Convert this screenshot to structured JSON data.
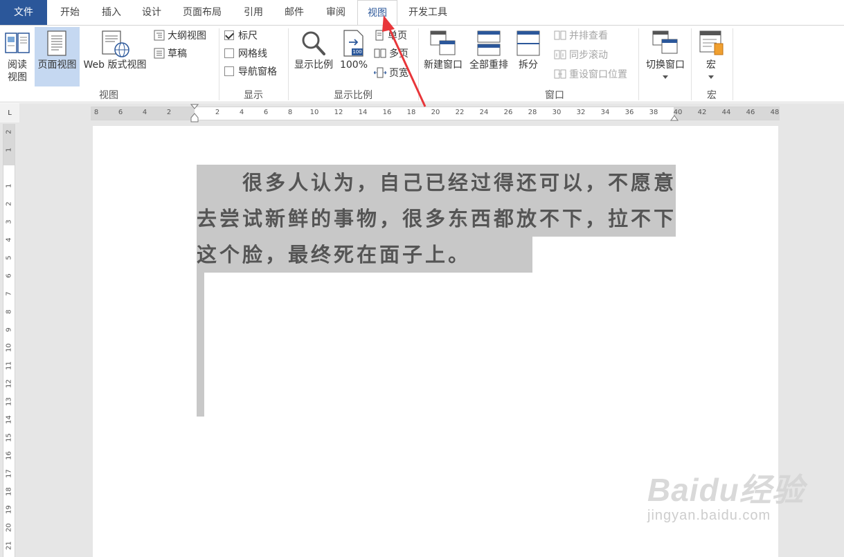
{
  "tabs": [
    {
      "label": "文件"
    },
    {
      "label": "开始"
    },
    {
      "label": "插入"
    },
    {
      "label": "设计"
    },
    {
      "label": "页面布局"
    },
    {
      "label": "引用"
    },
    {
      "label": "邮件"
    },
    {
      "label": "审阅"
    },
    {
      "label": "视图"
    },
    {
      "label": "开发工具"
    }
  ],
  "active_tab": "视图",
  "groups": {
    "views": {
      "label": "视图",
      "read_mode_line1": "阅读",
      "read_mode_line2": "视图",
      "print_layout": "页面视图",
      "web_layout": "Web 版式视图",
      "outline": "大纲视图",
      "draft": "草稿"
    },
    "show": {
      "label": "显示",
      "ruler": "标尺",
      "ruler_checked": true,
      "gridlines": "网格线",
      "gridlines_checked": false,
      "nav_pane": "导航窗格",
      "nav_pane_checked": false
    },
    "zoom": {
      "label": "显示比例",
      "zoom": "显示比例",
      "hundred": "100%",
      "one_page": "单页",
      "multi_page": "多页",
      "page_width": "页宽",
      "icon_badge": "100"
    },
    "window": {
      "label": "窗口",
      "new_window": "新建窗口",
      "arrange_all": "全部重排",
      "split": "拆分",
      "side_by_side": "并排查看",
      "sync_scroll": "同步滚动",
      "reset_position": "重设窗口位置",
      "switch_windows": "切换窗口"
    },
    "macros": {
      "label": "宏",
      "macros": "宏"
    }
  },
  "ruler": {
    "corner": "L",
    "h_labels": [
      "8",
      "6",
      "4",
      "2",
      "",
      "2",
      "4",
      "6",
      "8",
      "10",
      "12",
      "14",
      "16",
      "18",
      "20",
      "22",
      "24",
      "26",
      "28",
      "30",
      "32",
      "34",
      "36",
      "38",
      "40",
      "42",
      "44",
      "46",
      "48"
    ],
    "v_labels": [
      "2",
      "1",
      "",
      "1",
      "2",
      "3",
      "4",
      "5",
      "6",
      "7",
      "8",
      "9",
      "10",
      "11",
      "12",
      "13",
      "14",
      "15",
      "16",
      "17",
      "18",
      "19",
      "20",
      "21"
    ]
  },
  "document": {
    "line1": "　　很多人认为，自己已经过得还可以，不愿意",
    "line2": "去尝试新鲜的事物，很多东西都放不下，拉不下",
    "line3": "这个脸，最终死在面子上。"
  },
  "watermark": {
    "main": "Baidu经验",
    "sub": "jingyan.baidu.com"
  },
  "colors": {
    "file_tab": "#2b579a",
    "selected_view": "#c5d8f1",
    "selection": "#c8c8c8",
    "annotation_arrow": "#e8363a"
  }
}
